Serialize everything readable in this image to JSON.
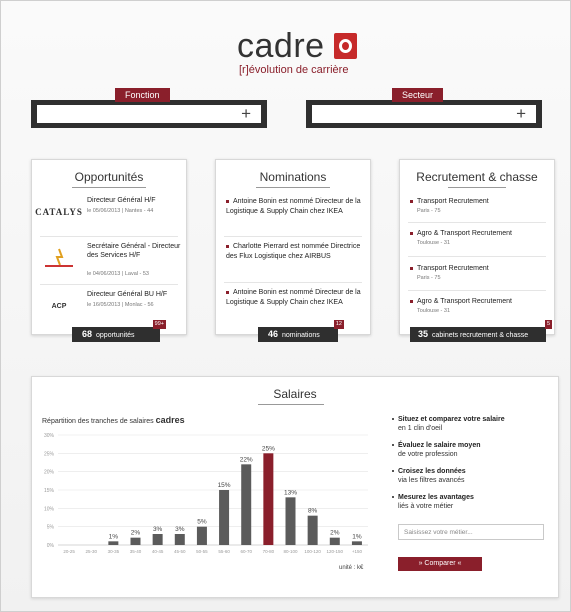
{
  "brand": {
    "name": "cadre",
    "tagline": "[r]évolution de carrière",
    "accent": "#8a1f2b",
    "logo_red": "#c62a2a"
  },
  "filters": {
    "fonction": {
      "label": "Fonction",
      "value": "",
      "add_icon": "plus-icon"
    },
    "secteur": {
      "label": "Secteur",
      "value": "",
      "add_icon": "plus-icon"
    }
  },
  "opportunites": {
    "title": "Opportunités",
    "items": [
      {
        "logo": "CATALYS",
        "title": "Directeur Général H/F",
        "meta": "le 05/06/2013 | Nantes - 44"
      },
      {
        "logo": "",
        "title": "Secrétaire Général - Directeur des Services H/F",
        "meta": "le 04/06/2013 | Laval - 53"
      },
      {
        "logo": "ACP",
        "title": "Directeur Général BU H/F",
        "meta": "le 16/05/2013 | Monlac - 56"
      }
    ],
    "count": "68",
    "count_label": "opportunités",
    "badge": "99+"
  },
  "nominations": {
    "title": "Nominations",
    "items": [
      "Antoine Bonin est nommé Directeur de la Logistique & Supply Chain chez IKEA",
      "Charlotte Pierrard est nommée Directrice des Flux Logistique chez AIRBUS",
      "Antoine Bonin est nommé Directeur de la Logistique & Supply Chain chez IKEA"
    ],
    "count": "46",
    "count_label": "nominations",
    "badge": "12"
  },
  "recrutement": {
    "title": "Recrutement & chasse",
    "items": [
      {
        "title": "Transport Recrutement",
        "loc": "Paris - 75"
      },
      {
        "title": "Agro & Transport Recrutement",
        "loc": "Toulouse - 31"
      },
      {
        "title": "Transport Recrutement",
        "loc": "Paris - 75"
      },
      {
        "title": "Agro & Transport Recrutement",
        "loc": "Toulouse - 31"
      }
    ],
    "count": "35",
    "count_label": "cabinets recrutement & chasse",
    "badge": "5"
  },
  "salaires": {
    "title": "Salaires",
    "chart_heading": "Répartition des tranches de salaires",
    "chart_heading_bold": "cadres",
    "unit": "unité : k€",
    "bullets": [
      {
        "bold": "Situez et comparez votre salaire",
        "rest": "en 1 clin d'oeil"
      },
      {
        "bold": "Évaluez le salaire moyen",
        "rest": "de votre profession"
      },
      {
        "bold": "Croisez les données",
        "rest": "via les filtres avancés"
      },
      {
        "bold": "Mesurez les avantages",
        "rest": "liés à votre métier"
      }
    ],
    "metier_placeholder": "Saisissez votre métier...",
    "compare_label": "»  Comparer  «"
  },
  "chart_data": {
    "type": "bar",
    "title": "Répartition des tranches de salaires cadres",
    "categories": [
      "20-25",
      "25-30",
      "30-35",
      "35-40",
      "40-45",
      "45-50",
      "50-55",
      "55-60",
      "60-70",
      "70-80",
      "80-100",
      "100-120",
      "120-150",
      "+150"
    ],
    "values": [
      0,
      0,
      1,
      2,
      3,
      3,
      5,
      15,
      22,
      25,
      13,
      8,
      2,
      1
    ],
    "value_labels": [
      "",
      "",
      "1%",
      "2%",
      "3%",
      "3%",
      "5%",
      "15%",
      "22%",
      "25%",
      "13%",
      "8%",
      "2%",
      "1%"
    ],
    "y_ticks": [
      "0%",
      "5%",
      "10%",
      "15%",
      "20%",
      "25%",
      "30%"
    ],
    "ylim": [
      0,
      30
    ],
    "highlight_index": 9,
    "bar_color": "#5b5b5b",
    "highlight_color": "#8a1f2b",
    "grid": true
  }
}
